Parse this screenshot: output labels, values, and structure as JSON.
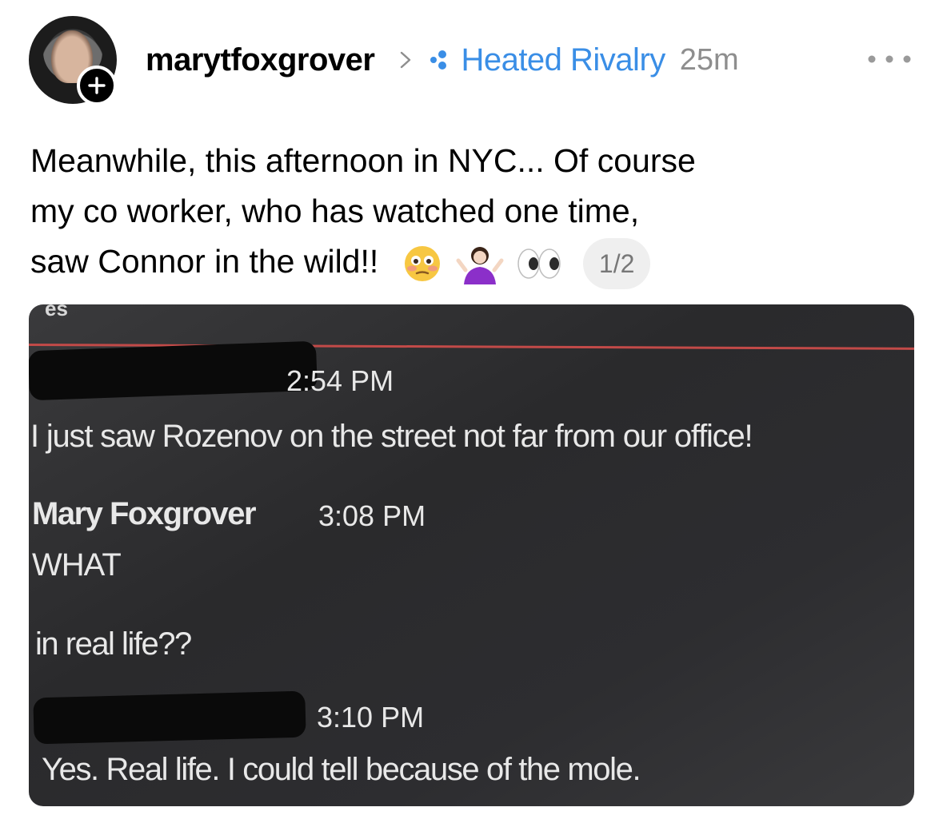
{
  "post": {
    "username": "marytfoxgrover",
    "community": "Heated Rivalry",
    "time_ago": "25m",
    "text_lines": [
      "Meanwhile, this afternoon in NYC... Of course",
      "my co worker, who has watched one time,",
      "saw Connor in the wild!!"
    ],
    "emojis": [
      "flushed-face",
      "person-shrugging",
      "eyes"
    ],
    "pager": "1/2"
  },
  "photo": {
    "top_fragment": "es",
    "messages": [
      {
        "timestamp": "2:54 PM",
        "lines": [
          "I just saw Rozenov on the street not far from our office!"
        ]
      },
      {
        "sender": "Mary Foxgrover",
        "timestamp": "3:08 PM",
        "lines": [
          "WHAT",
          "in real life??"
        ]
      },
      {
        "timestamp": "3:10 PM",
        "lines": [
          "Yes. Real life. I could tell because of the mole."
        ]
      }
    ]
  },
  "colors": {
    "community_blue": "#3a8ee6",
    "meta_gray": "#8e8e8e",
    "photo_red_line": "#c24a48"
  }
}
